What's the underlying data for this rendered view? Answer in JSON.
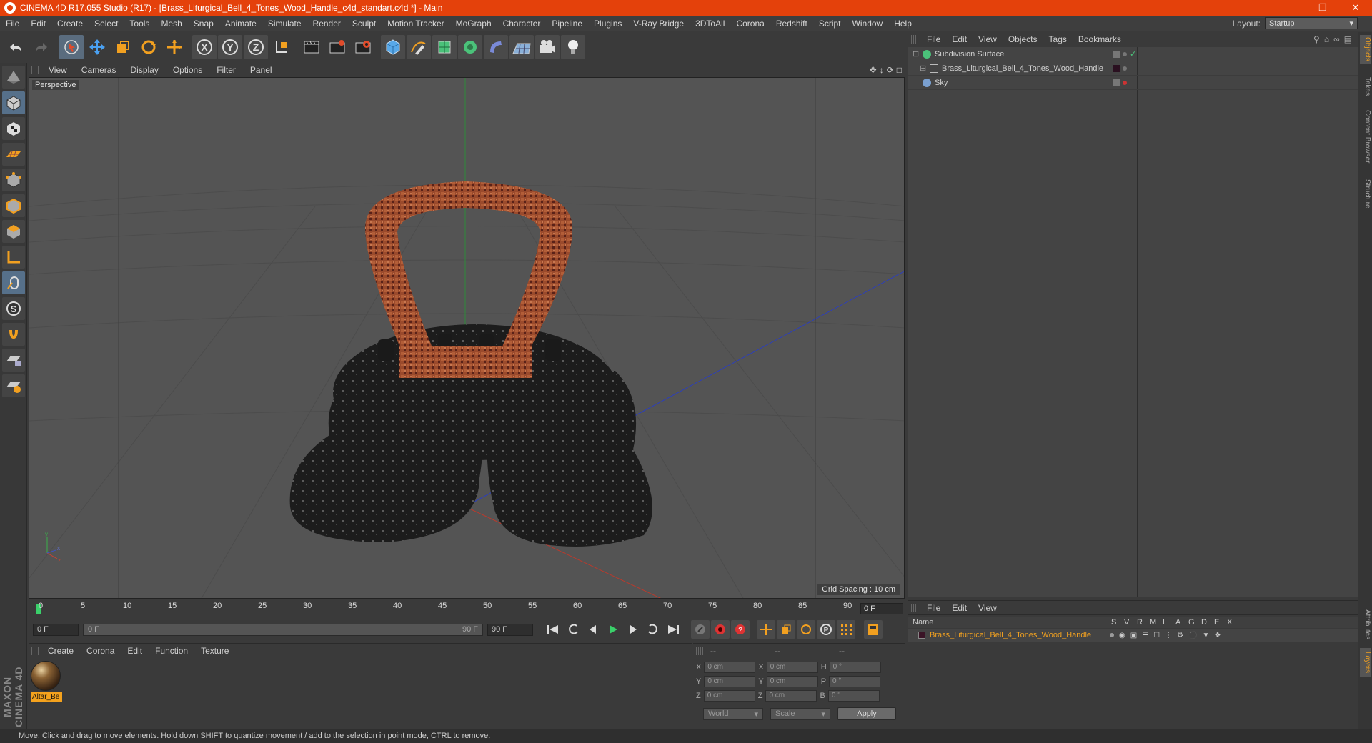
{
  "window": {
    "title": "CINEMA 4D R17.055 Studio (R17) - [Brass_Liturgical_Bell_4_Tones_Wood_Handle_c4d_standart.c4d *] - Main",
    "controls": [
      "minimize",
      "restore",
      "close"
    ]
  },
  "menubar": {
    "items": [
      "File",
      "Edit",
      "Create",
      "Select",
      "Tools",
      "Mesh",
      "Snap",
      "Animate",
      "Simulate",
      "Render",
      "Sculpt",
      "Motion Tracker",
      "MoGraph",
      "Character",
      "Pipeline",
      "Plugins",
      "V-Ray Bridge",
      "3DToAll",
      "Corona",
      "Redshift",
      "Script",
      "Window",
      "Help"
    ],
    "layout_label": "Layout:",
    "layout_value": "Startup"
  },
  "viewport": {
    "menu": [
      "View",
      "Cameras",
      "Display",
      "Options",
      "Filter",
      "Panel"
    ],
    "label": "Perspective",
    "grid_spacing": "Grid Spacing : 10 cm"
  },
  "timeline": {
    "ticks": [
      "0",
      "5",
      "10",
      "15",
      "20",
      "25",
      "30",
      "35",
      "40",
      "45",
      "50",
      "55",
      "60",
      "65",
      "70",
      "75",
      "80",
      "85",
      "90"
    ],
    "current_frame": "0 F"
  },
  "transport": {
    "start_field": "0 F",
    "slider_left": "0 F",
    "slider_right": "90 F",
    "end_field": "90 F"
  },
  "material_panel": {
    "menu": [
      "Create",
      "Corona",
      "Edit",
      "Function",
      "Texture"
    ],
    "materials": [
      {
        "name": "Altar_Be"
      }
    ]
  },
  "coordinates": {
    "headers": [
      "--",
      "--",
      "--"
    ],
    "rows": [
      {
        "a": "X",
        "av": "0 cm",
        "b": "X",
        "bv": "0 cm",
        "c": "H",
        "cv": "0 °"
      },
      {
        "a": "Y",
        "av": "0 cm",
        "b": "Y",
        "bv": "0 cm",
        "c": "P",
        "cv": "0 °"
      },
      {
        "a": "Z",
        "av": "0 cm",
        "b": "Z",
        "bv": "0 cm",
        "c": "B",
        "cv": "0 °"
      }
    ],
    "world": "World",
    "scale": "Scale",
    "apply": "Apply"
  },
  "object_manager": {
    "menu": [
      "File",
      "Edit",
      "View",
      "Objects",
      "Tags",
      "Bookmarks"
    ],
    "objects": [
      {
        "name": "Subdivision Surface",
        "color": "#4bc27a"
      },
      {
        "name": "Brass_Liturgical_Bell_4_Tones_Wood_Handle",
        "color": "#aaaaaa"
      },
      {
        "name": "Sky",
        "color": "#7aa0d0"
      }
    ]
  },
  "layer_manager": {
    "menu": [
      "File",
      "Edit",
      "View"
    ],
    "columns": [
      "Name",
      "S",
      "V",
      "R",
      "M",
      "L",
      "A",
      "G",
      "D",
      "E",
      "X"
    ],
    "layers": [
      {
        "name": "Brass_Liturgical_Bell_4_Tones_Wood_Handle",
        "color": "#f0a020"
      }
    ]
  },
  "right_tabs": [
    "Objects",
    "Takes",
    "Content Browser",
    "Structure",
    "Attributes",
    "Layers"
  ],
  "status": "Move: Click and drag to move elements. Hold down SHIFT to quantize movement / add to the selection in point mode, CTRL to remove.",
  "branding": "MAXON CINEMA 4D"
}
